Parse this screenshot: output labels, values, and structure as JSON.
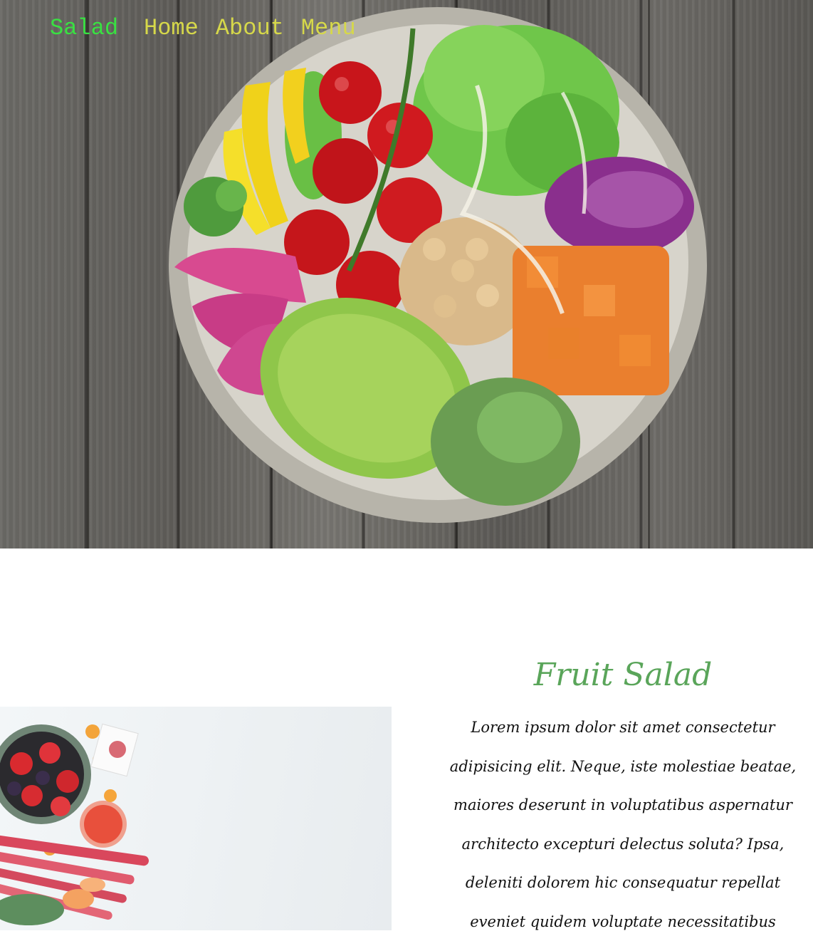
{
  "nav": {
    "brand": "Salad",
    "links": [
      "Home",
      "About",
      "Menu"
    ]
  },
  "section": {
    "title": "Fruit Salad",
    "text": "Lorem ipsum dolor sit amet consectetur adipisicing elit. Neque, iste molestiae beatae, maiores deserunt in voluptatibus aspernatur architecto excepturi delectus soluta? Ipsa, deleniti dolorem hic consequatur repellat eveniet quidem voluptate necessitatibus"
  },
  "colors": {
    "brand": "#39e142",
    "nav_link": "#d6d84a",
    "title": "#5aa55a",
    "text": "#111111"
  }
}
